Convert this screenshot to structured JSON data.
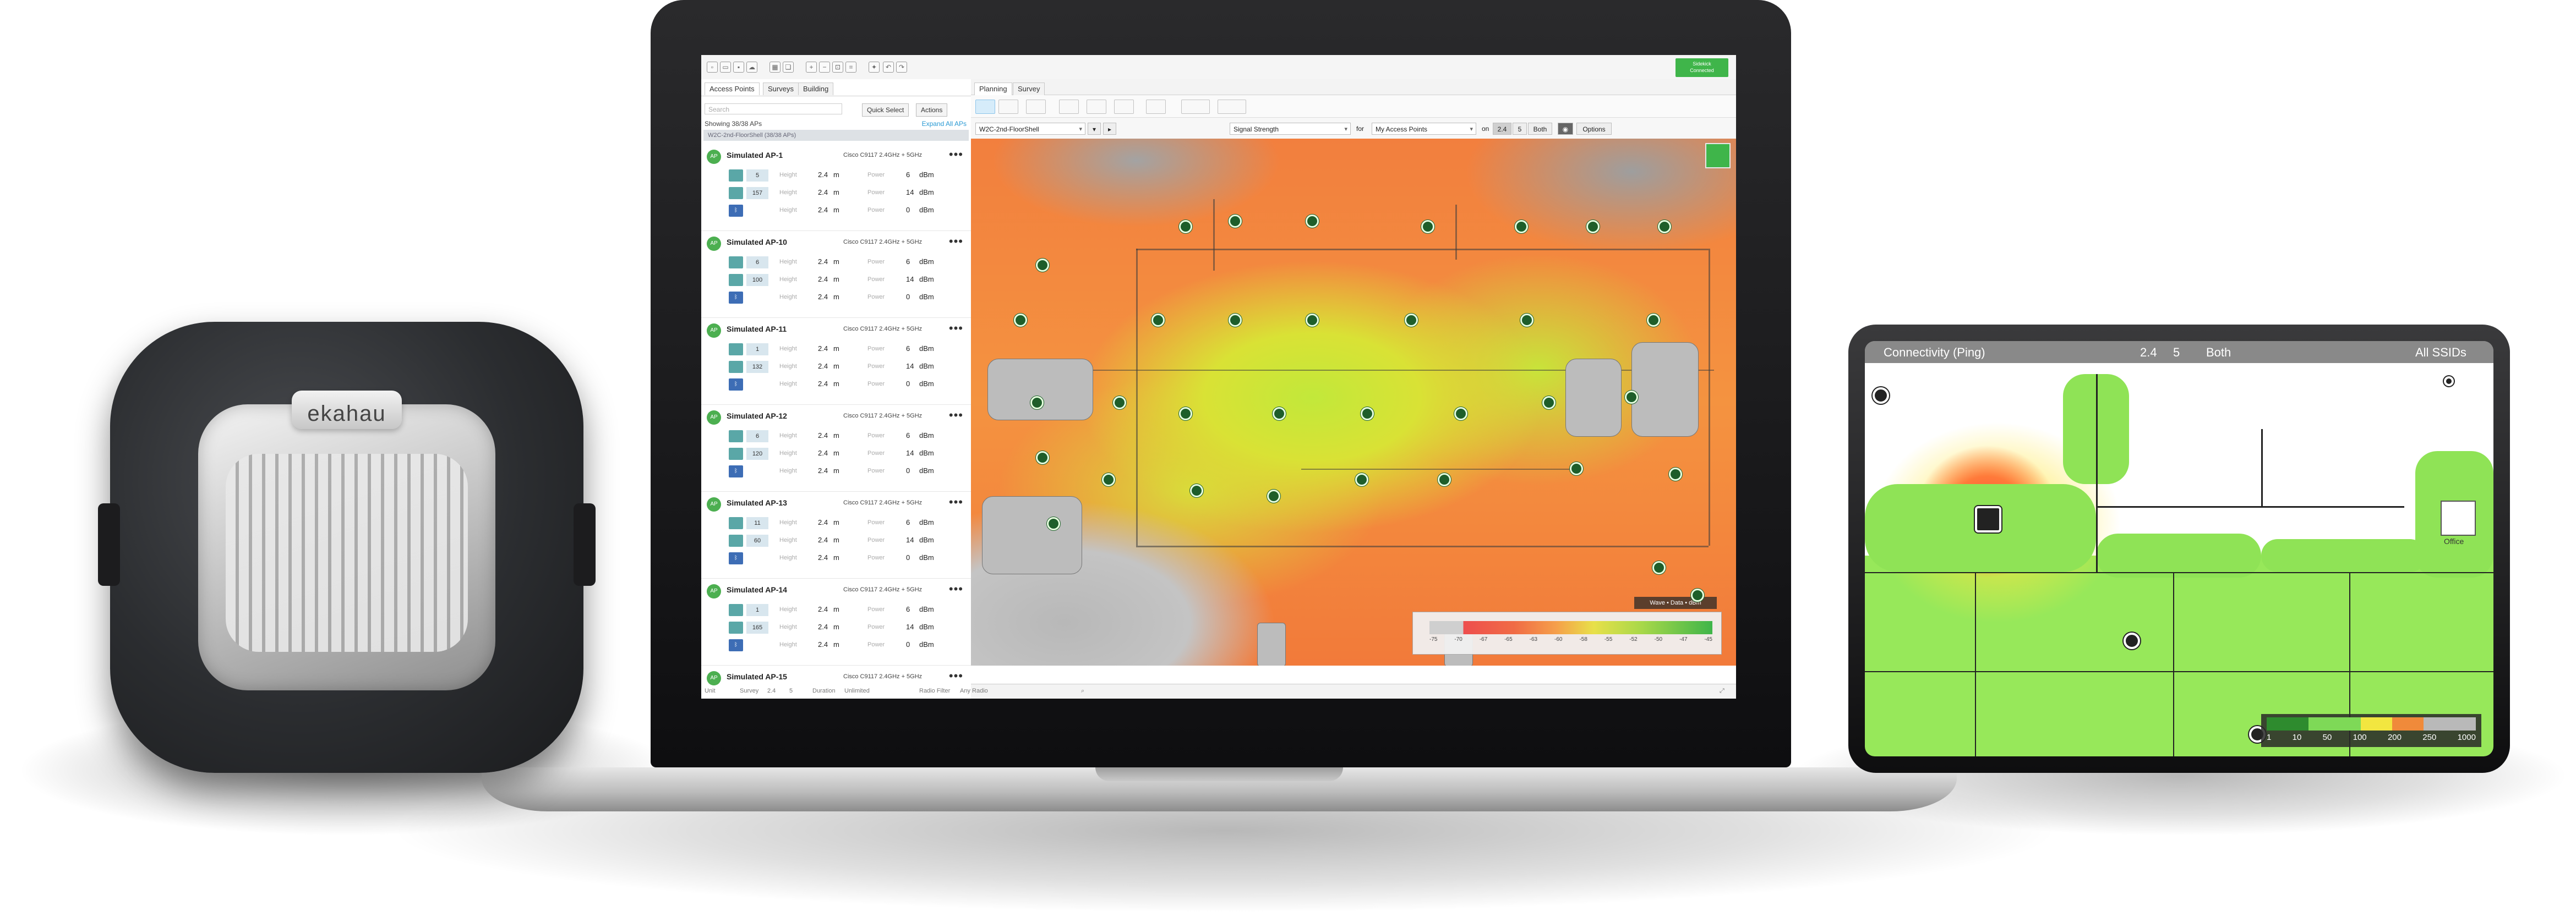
{
  "sensor": {
    "brand": "ekahau"
  },
  "app": {
    "toolbar": {
      "status_line1": "Sidekick",
      "status_line2": "Connected"
    },
    "left_panel": {
      "tabs": [
        "Access Points",
        "Surveys",
        "Building"
      ],
      "search_placeholder": "Search",
      "quick_select": "Quick Select",
      "actions": "Actions",
      "showing": "Showing 38/38 APs",
      "expand_all": "Expand All APs",
      "group_label": "W2C-2nd-FloorShell (38/38 APs)",
      "label_height": "Height",
      "label_power": "Power",
      "unit_m": "m",
      "unit_dbm": "dBm",
      "aps": [
        {
          "badge": "AP",
          "name": "Simulated AP-1",
          "model": "Cisco C9117 2.4GHz + 5GHz",
          "ch1": "5",
          "ch2": "157",
          "h1": "2.4",
          "h2": "2.4",
          "h3": "2.4",
          "p1": "6",
          "p2": "14",
          "p3": "0"
        },
        {
          "badge": "AP",
          "name": "Simulated AP-10",
          "model": "Cisco C9117 2.4GHz + 5GHz",
          "ch1": "6",
          "ch2": "100",
          "h1": "2.4",
          "h2": "2.4",
          "h3": "2.4",
          "p1": "6",
          "p2": "14",
          "p3": "0"
        },
        {
          "badge": "AP",
          "name": "Simulated AP-11",
          "model": "Cisco C9117 2.4GHz + 5GHz",
          "ch1": "1",
          "ch2": "132",
          "h1": "2.4",
          "h2": "2.4",
          "h3": "2.4",
          "p1": "6",
          "p2": "14",
          "p3": "0"
        },
        {
          "badge": "AP",
          "name": "Simulated AP-12",
          "model": "Cisco C9117 2.4GHz + 5GHz",
          "ch1": "6",
          "ch2": "120",
          "h1": "2.4",
          "h2": "2.4",
          "h3": "2.4",
          "p1": "6",
          "p2": "14",
          "p3": "0"
        },
        {
          "badge": "AP",
          "name": "Simulated AP-13",
          "model": "Cisco C9117 2.4GHz + 5GHz",
          "ch1": "11",
          "ch2": "60",
          "h1": "2.4",
          "h2": "2.4",
          "h3": "2.4",
          "p1": "6",
          "p2": "14",
          "p3": "0"
        },
        {
          "badge": "AP",
          "name": "Simulated AP-14",
          "model": "Cisco C9117 2.4GHz + 5GHz",
          "ch1": "1",
          "ch2": "165",
          "h1": "2.4",
          "h2": "2.4",
          "h3": "2.4",
          "p1": "6",
          "p2": "14",
          "p3": "0"
        },
        {
          "badge": "AP",
          "name": "Simulated AP-15",
          "model": "Cisco C9117 2.4GHz + 5GHz",
          "ch1": "",
          "ch2": "",
          "h1": "",
          "h2": "",
          "h3": "",
          "p1": "",
          "p2": "",
          "p3": ""
        }
      ]
    },
    "right_panel": {
      "tabs": [
        "Planning",
        "Survey"
      ],
      "floor_select": "W2C-2nd-FloorShell",
      "metric_select": "Signal Strength",
      "for_label": "for",
      "target_select": "My Access Points",
      "on_label": "on",
      "band_24": "2.4",
      "band_5": "5",
      "band_both": "Both",
      "options": "Options",
      "legend_title": "Wave • Data • dBm",
      "legend_ticks": [
        "-75",
        "-70",
        "-67",
        "-65",
        "-63",
        "-60",
        "-58",
        "-55",
        "-52",
        "-50",
        "-47",
        "-45"
      ],
      "statusbar": {
        "unit": "Unit",
        "survey": "Survey",
        "survey_val": "2.4",
        "five": "5",
        "duration": "Duration",
        "duration_val": "Unlimited",
        "radio_filter": "Radio Filter",
        "radio_val": "Any Radio"
      }
    },
    "colors": {
      "green": "#3fb54a",
      "accent": "#2a9ad4"
    }
  },
  "tablet": {
    "title": "Connectivity (Ping)",
    "band": "2.4",
    "band2": "5",
    "both": "Both",
    "ssids": "All SSIDs",
    "office": "Office",
    "legend_ticks": [
      "1",
      "10",
      "50",
      "100",
      "200",
      "250",
      "1000"
    ]
  }
}
